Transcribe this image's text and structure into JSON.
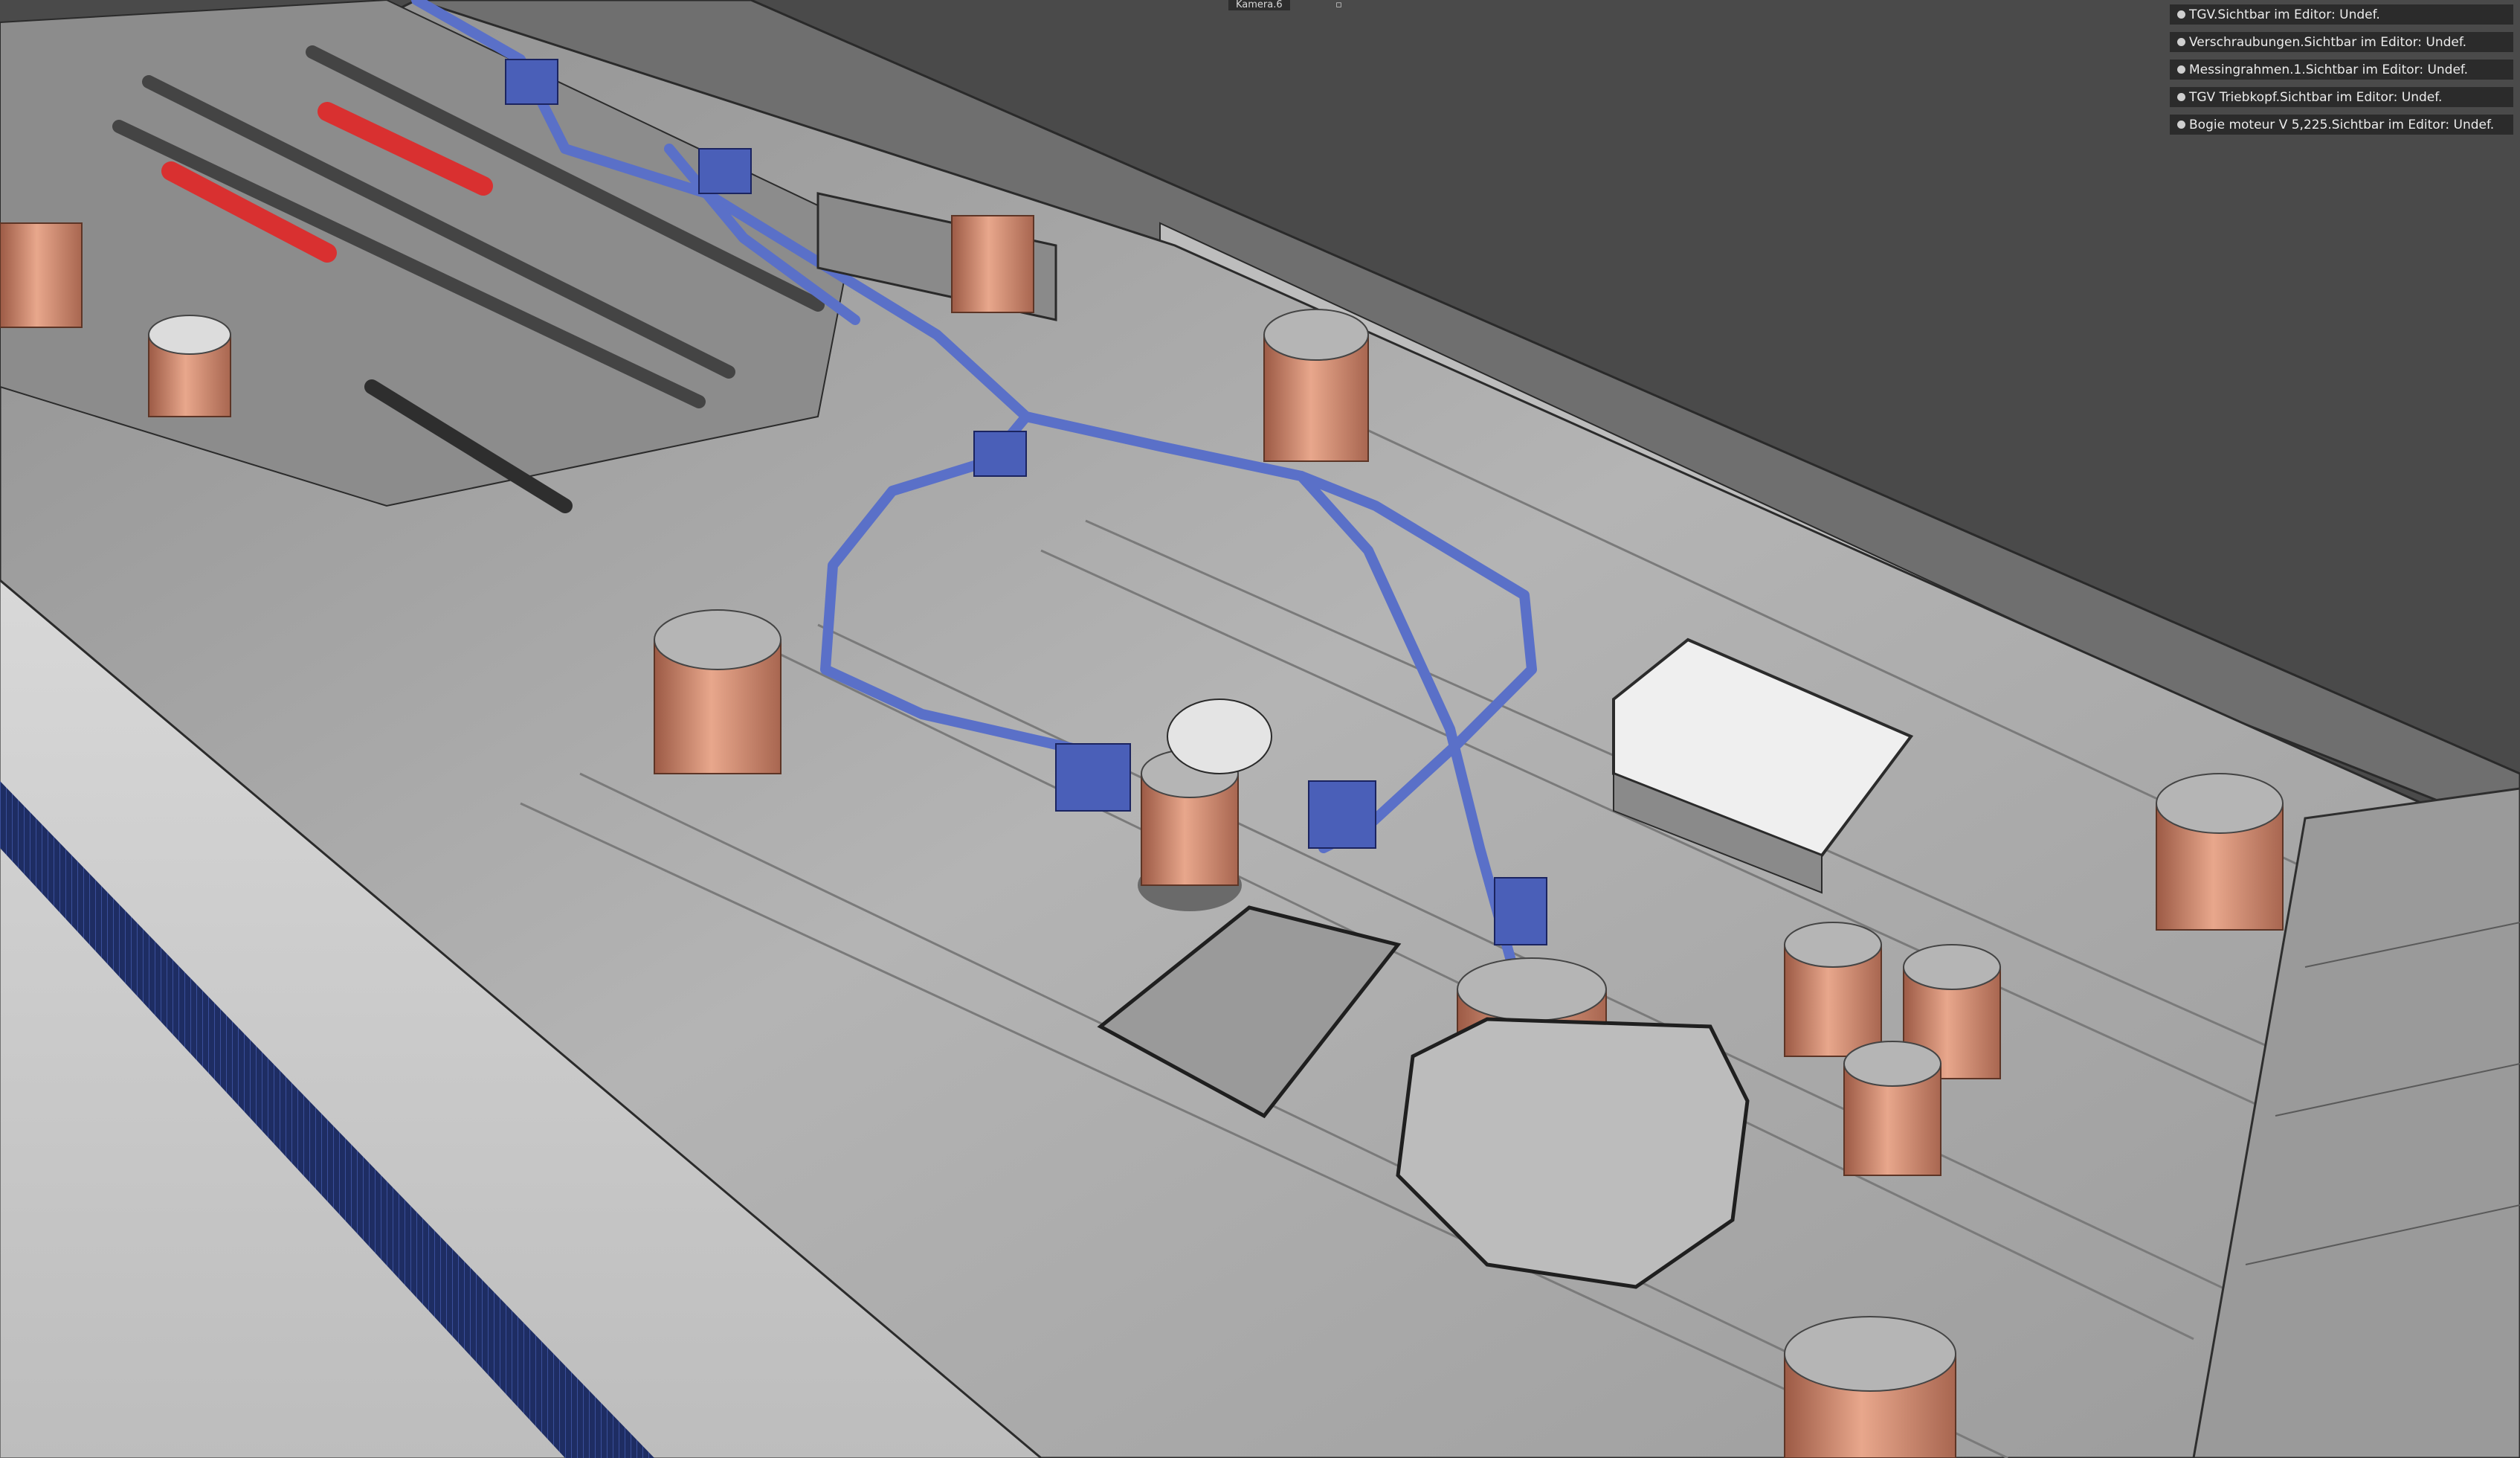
{
  "viewport": {
    "camera_label": "Kamera.6",
    "camera_corner_icon": "overlay-marker-icon"
  },
  "hud": {
    "rows": [
      {
        "text": "TGV.Sichtbar im Editor: Undef."
      },
      {
        "text": "Verschraubungen.Sichtbar im Editor: Undef."
      },
      {
        "text": "Messingrahmen.1.Sichtbar im Editor: Undef."
      },
      {
        "text": "TGV Triebkopf.Sichtbar im Editor: Undef."
      },
      {
        "text": "Bogie moteur V 5,225.Sichtbar im Editor: Undef."
      }
    ]
  },
  "colors": {
    "background": "#4a4a4a",
    "roof": "#a9a9a9",
    "insulator": "#c98a71",
    "pipe": "#5a70c8",
    "red_spring": "#d93030",
    "stripe": "#1f2f6a"
  }
}
